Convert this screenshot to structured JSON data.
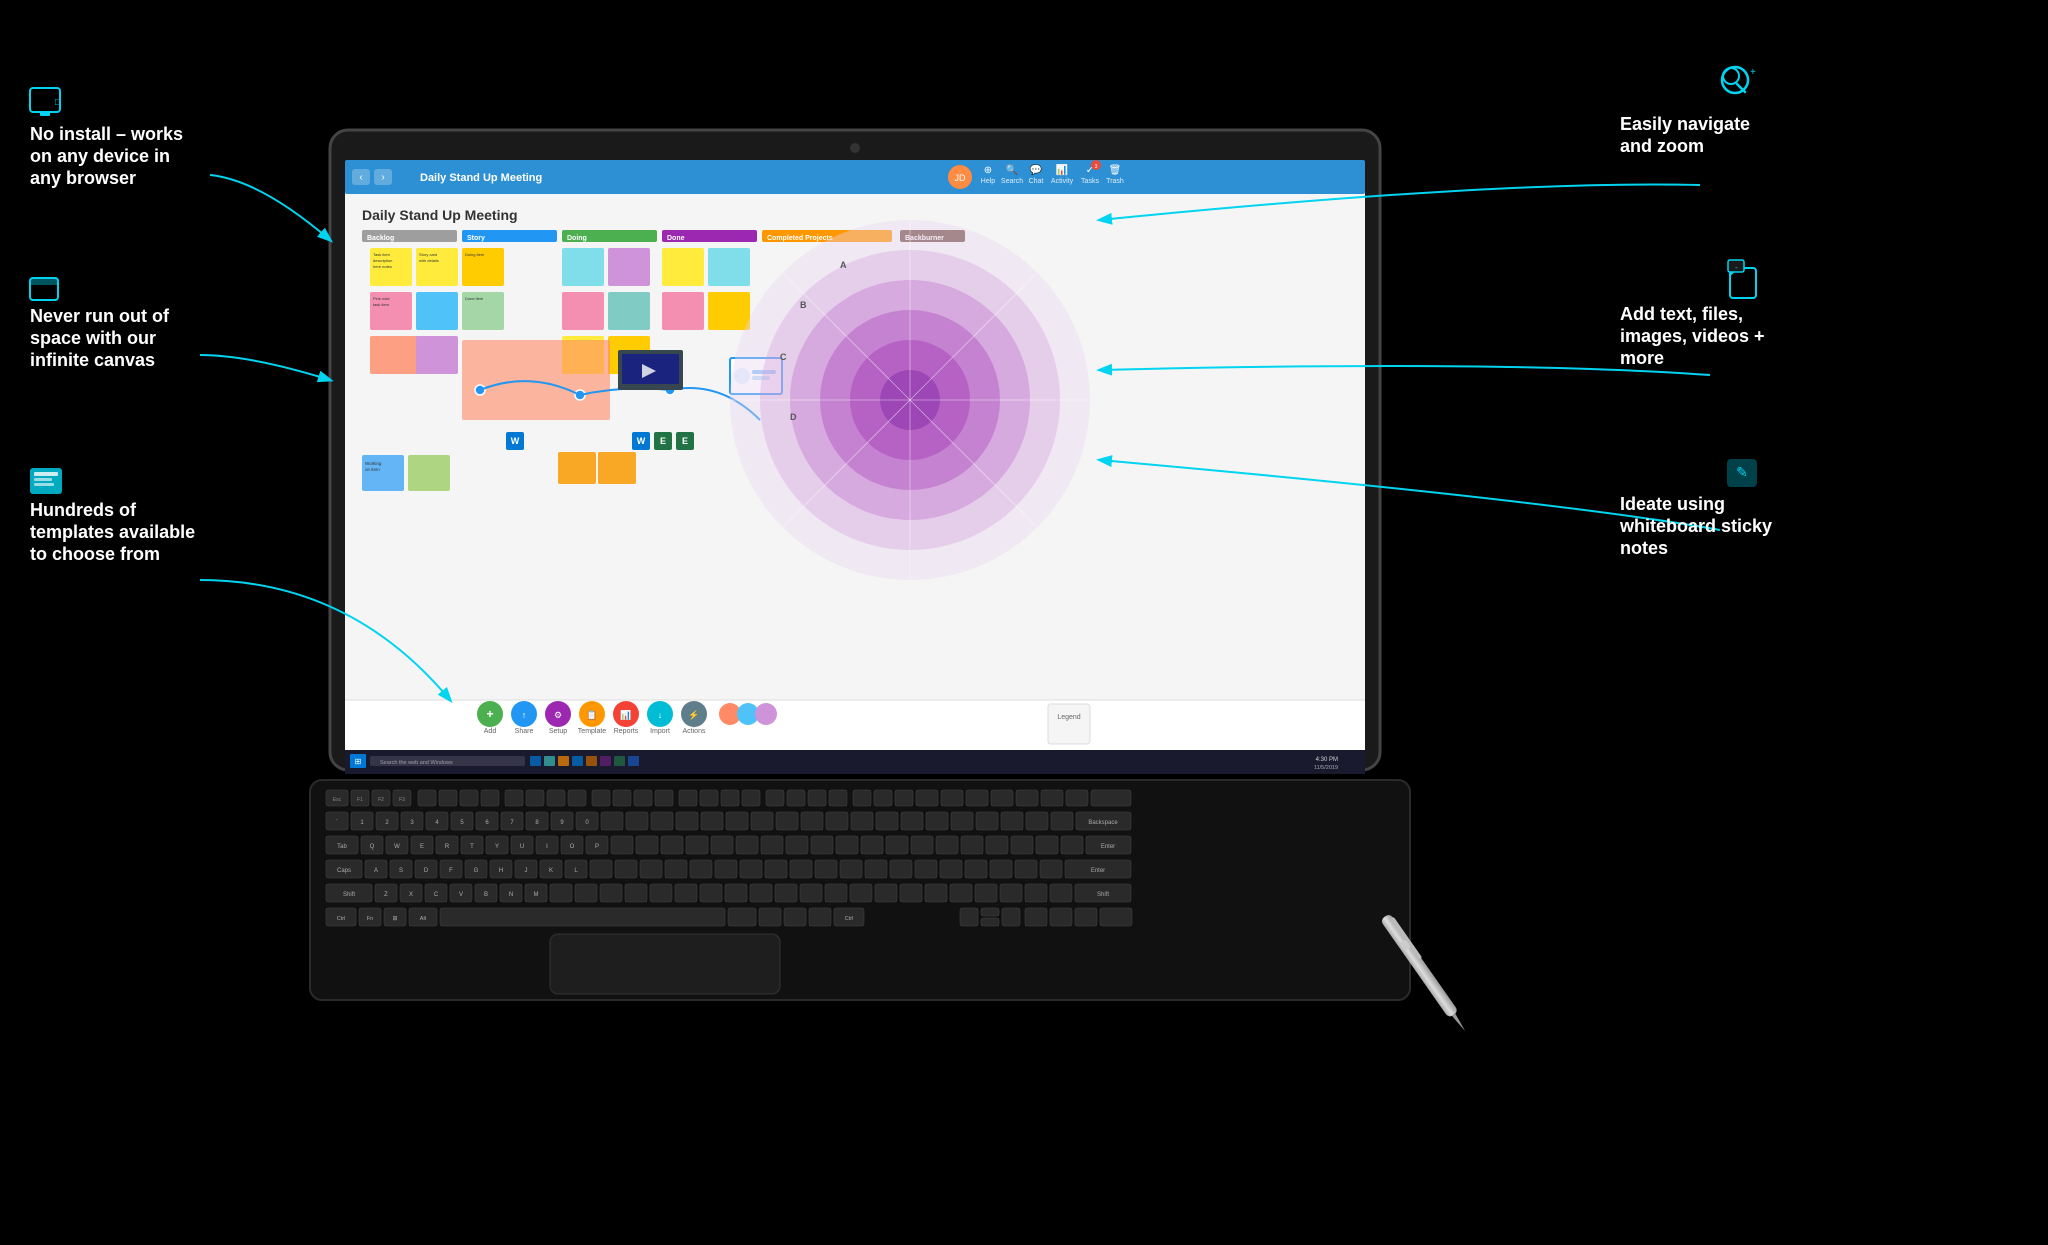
{
  "background": "#000000",
  "app": {
    "title": "Daily Stand Up Meeting",
    "toolbar": {
      "back_label": "‹",
      "forward_label": "›",
      "help_label": "Help",
      "search_label": "Search",
      "chat_label": "Chat",
      "activity_label": "Activity",
      "tasks_label": "Tasks",
      "trash_label": "Trash"
    },
    "canvas_title": "Daily Stand Up Meeting",
    "bottom_tools": [
      {
        "label": "Add",
        "color": "#4CAF50"
      },
      {
        "label": "Share",
        "color": "#2196F3"
      },
      {
        "label": "Setup",
        "color": "#9C27B0"
      },
      {
        "label": "Template",
        "color": "#FF9800"
      },
      {
        "label": "Reports",
        "color": "#F44336"
      },
      {
        "label": "Import",
        "color": "#00BCD4"
      },
      {
        "label": "Actions",
        "color": "#607D8B"
      },
      {
        "label": "Legend",
        "color": "#795548"
      }
    ]
  },
  "features": [
    {
      "id": "no-install",
      "icon": "🖥",
      "text": "No install – works on any device in any browser",
      "position": "top-left"
    },
    {
      "id": "infinite-canvas",
      "icon": "📋",
      "text": "Never run out of space with our infinite canvas",
      "position": "mid-left"
    },
    {
      "id": "templates",
      "icon": "📑",
      "text": "Hundreds of templates available to choose from",
      "position": "bottom-left"
    },
    {
      "id": "navigate-zoom",
      "icon": "🔍",
      "text": "Easily navigate and zoom",
      "position": "top-right"
    },
    {
      "id": "add-content",
      "icon": "📄",
      "text": "Add text, files, images, videos + more",
      "position": "mid-right"
    },
    {
      "id": "sticky-notes",
      "icon": "📝",
      "text": "Ideate using whiteboard sticky notes",
      "position": "bottom-right"
    }
  ],
  "taskbar": {
    "search_placeholder": "Search the web and Windows",
    "clock": "4:30 PM"
  },
  "template_label": "Template"
}
